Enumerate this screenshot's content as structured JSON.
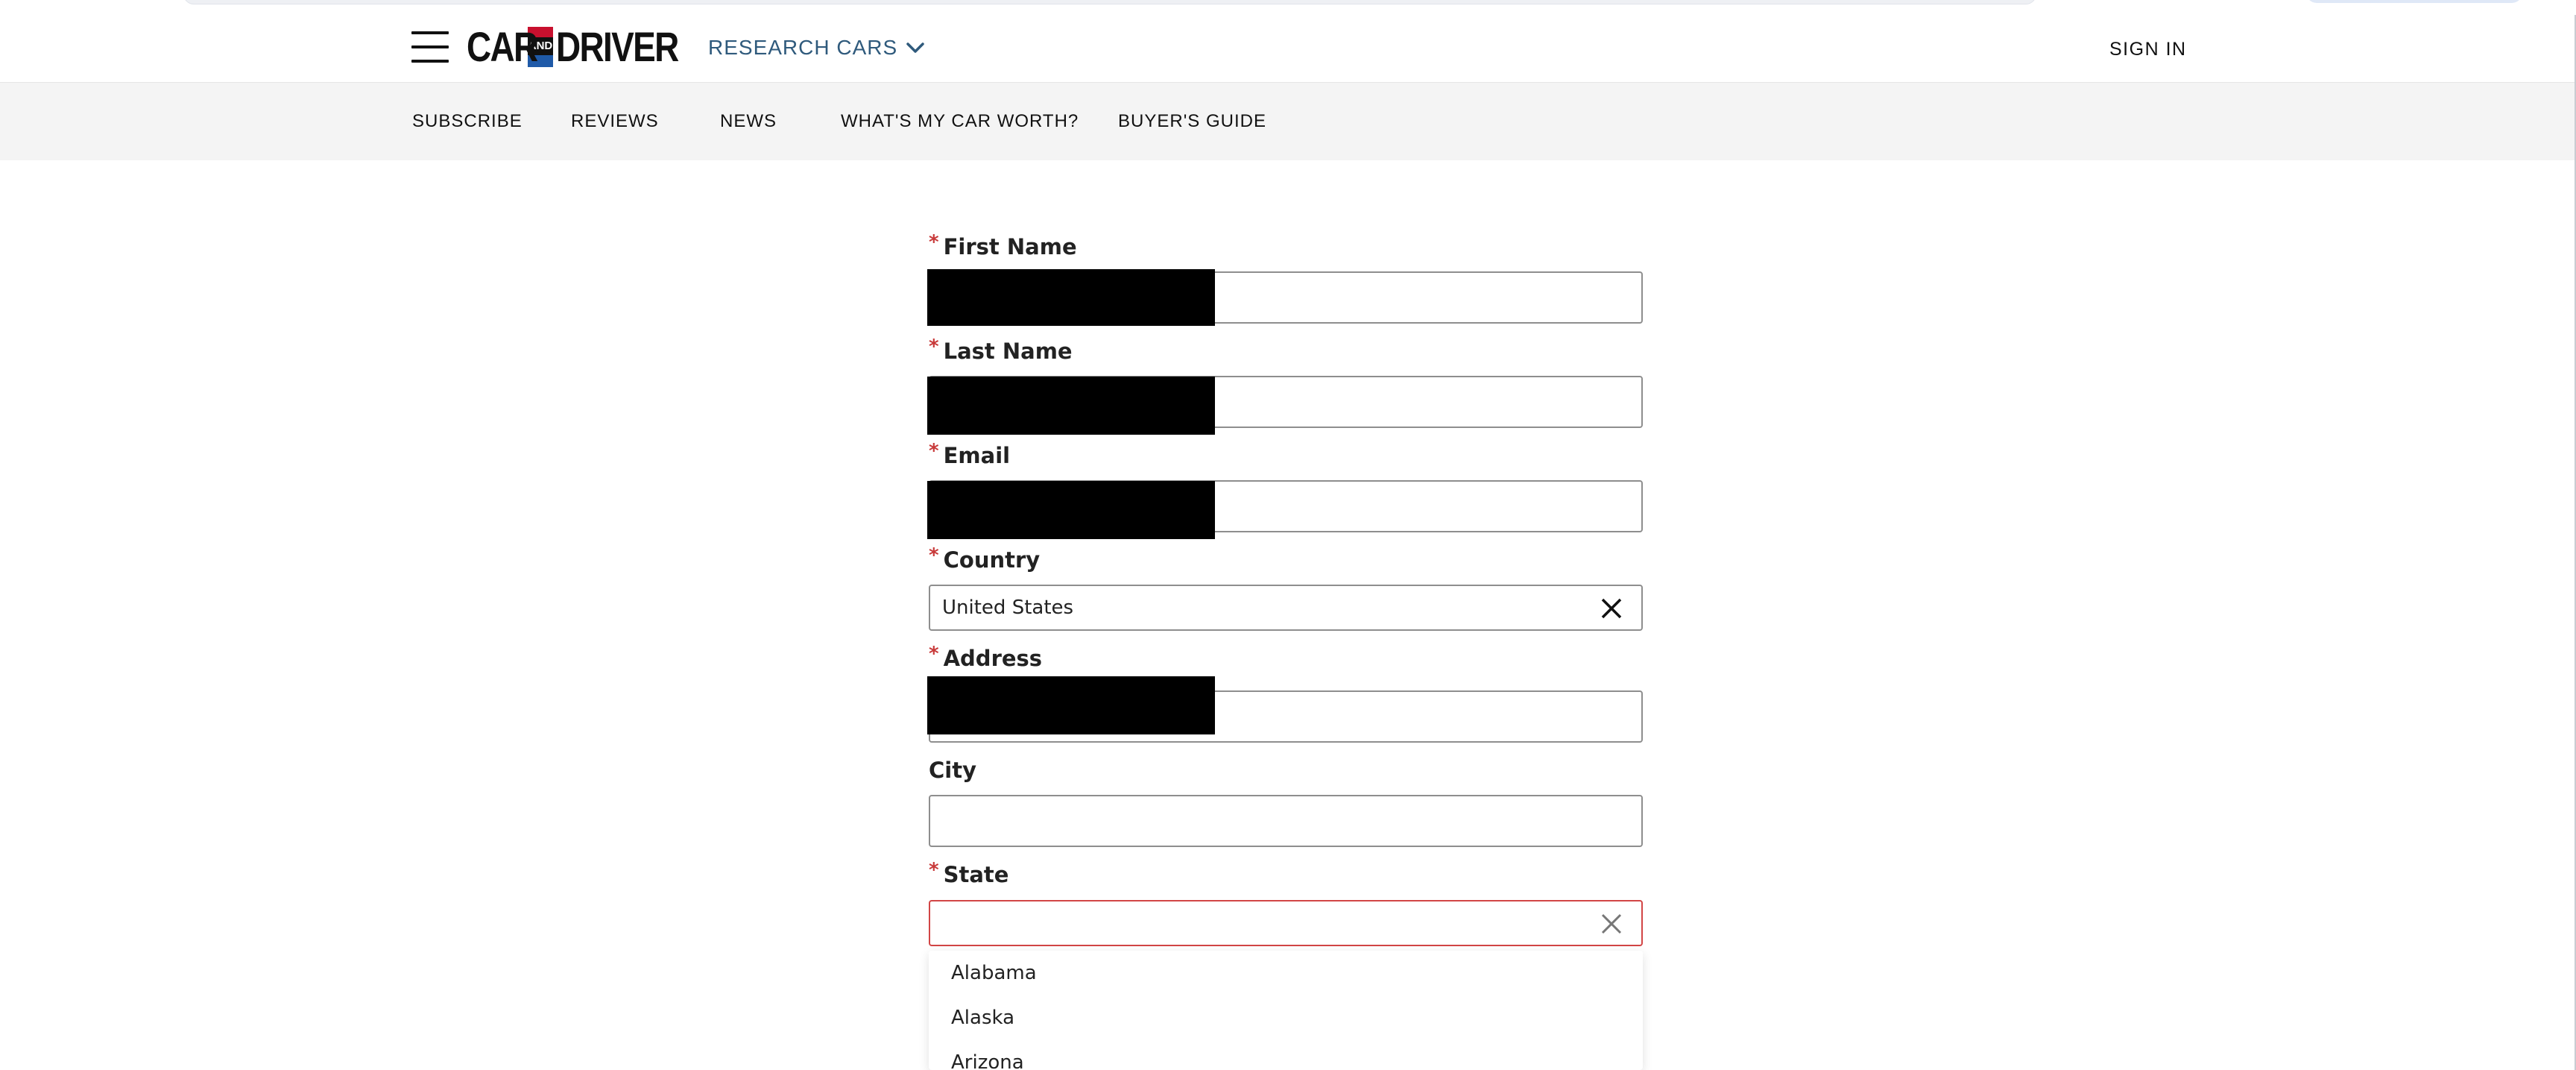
{
  "header": {
    "logo": {
      "part1": "CAR",
      "part2": "AND",
      "part3": "DRIVER"
    },
    "research_label": "RESEARCH CARS",
    "signin_label": "SIGN IN"
  },
  "subnav": {
    "items": [
      {
        "label": "SUBSCRIBE"
      },
      {
        "label": "REVIEWS"
      },
      {
        "label": "NEWS"
      },
      {
        "label": "WHAT'S MY CAR WORTH?"
      },
      {
        "label": "BUYER'S GUIDE"
      }
    ]
  },
  "form": {
    "required_marker": "*",
    "first_name": {
      "label": "First Name",
      "value": ""
    },
    "last_name": {
      "label": "Last Name",
      "value": ""
    },
    "email": {
      "label": "Email",
      "value": ""
    },
    "country": {
      "label": "Country",
      "value": "United States"
    },
    "address": {
      "label": "Address",
      "value": ""
    },
    "city": {
      "label": "City",
      "value": ""
    },
    "state": {
      "label": "State",
      "value": "",
      "options": [
        "Alabama",
        "Alaska",
        "Arizona"
      ]
    }
  },
  "colors": {
    "accent_blue": "#2f5a7c",
    "required_red": "#c83a3a",
    "error_border": "#d24545",
    "subnav_bg": "#f4f4f4"
  }
}
